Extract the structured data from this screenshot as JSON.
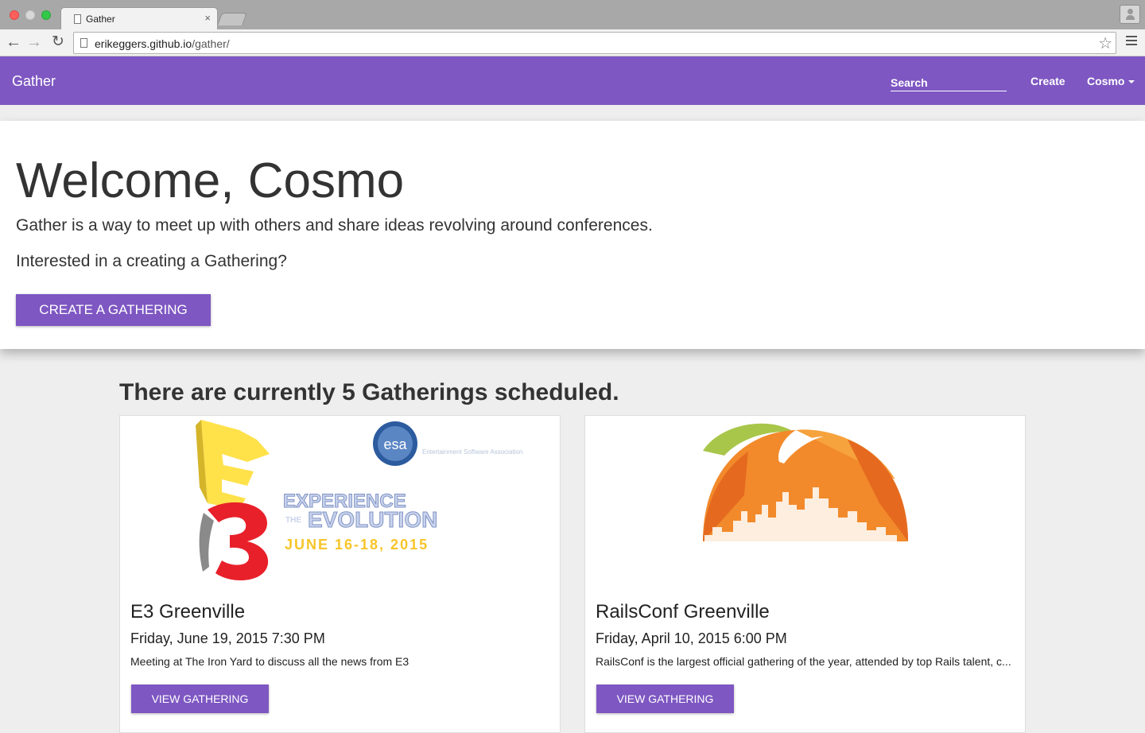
{
  "browser": {
    "tab_title": "Gather",
    "tab_close": "×",
    "url_host": "erikeggers.github.io",
    "url_path": "/gather/",
    "icons": [
      "back-icon",
      "forward-icon",
      "reload-icon",
      "star-icon",
      "menu-icon",
      "profile-icon"
    ]
  },
  "appbar": {
    "brand": "Gather",
    "search_placeholder": "Search",
    "create_label": "Create",
    "user_label": "Cosmo",
    "color": "#7e57c2"
  },
  "hero": {
    "heading": "Welcome, Cosmo",
    "line1": "Gather is a way to meet up with others and share ideas revolving around conferences.",
    "line2": "Interested in a creating a Gathering?",
    "cta": "CREATE A GATHERING"
  },
  "gatherings": {
    "summary": "There are currently 5 Gatherings scheduled.",
    "cards": [
      {
        "title": "E3 Greenville",
        "date": "Friday, June 19, 2015 7:30 PM",
        "description": "Meeting at The Iron Yard to discuss all the news from E3",
        "button": "VIEW GATHERING",
        "image": {
          "org": "esa",
          "org_caption": "Entertainment Software Association",
          "tag1": "EXPERIENCE",
          "tag_the": "THE",
          "tag2": "EVOLUTION",
          "dates": "JUNE 16-18, 2015"
        }
      },
      {
        "title": "RailsConf Greenville",
        "date": "Friday, April 10, 2015 6:00 PM",
        "description": "RailsConf is the largest official gathering of the year, attended by top Rails talent, c...",
        "button": "VIEW GATHERING",
        "image": {}
      }
    ]
  }
}
